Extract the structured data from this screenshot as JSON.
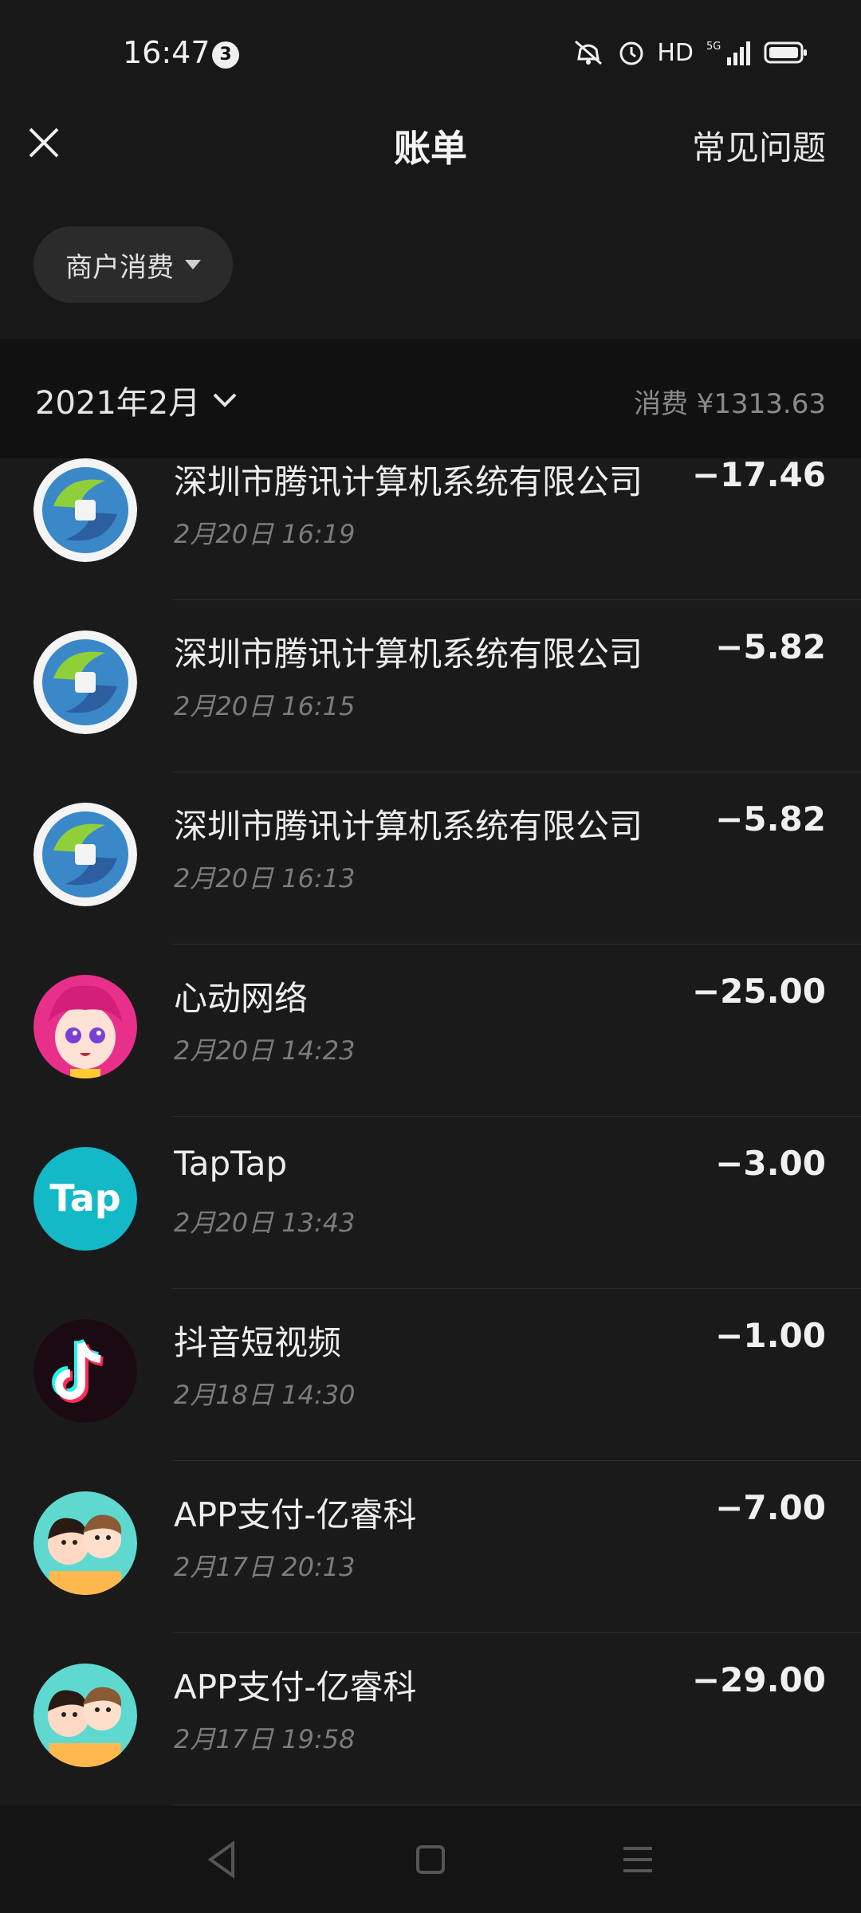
{
  "status": {
    "time": "16:47",
    "notif_count": "3",
    "hd": "HD",
    "network": "5G"
  },
  "header": {
    "title": "账单",
    "faq": "常见问题"
  },
  "filter": {
    "label": "商户消费"
  },
  "month": {
    "label": "2021年2月",
    "summary": "消费 ¥1313.63"
  },
  "transactions": [
    {
      "merchant": "深圳市腾讯计算机系统有限公司",
      "time": "2月20日 16:19",
      "amount": "−17.46",
      "icon": "tencent-logo-icon"
    },
    {
      "merchant": "深圳市腾讯计算机系统有限公司",
      "time": "2月20日 16:15",
      "amount": "−5.82",
      "icon": "tencent-logo-icon"
    },
    {
      "merchant": "深圳市腾讯计算机系统有限公司",
      "time": "2月20日 16:13",
      "amount": "−5.82",
      "icon": "tencent-logo-icon"
    },
    {
      "merchant": "心动网络",
      "time": "2月20日 14:23",
      "amount": "−25.00",
      "icon": "anime-girl-avatar-icon"
    },
    {
      "merchant": "TapTap",
      "time": "2月20日 13:43",
      "amount": "−3.00",
      "icon": "taptap-logo-icon"
    },
    {
      "merchant": "抖音短视频",
      "time": "2月18日 14:30",
      "amount": "−1.00",
      "icon": "tiktok-logo-icon"
    },
    {
      "merchant": "APP支付-亿睿科",
      "time": "2月17日 20:13",
      "amount": "−7.00",
      "icon": "couple-avatar-icon"
    },
    {
      "merchant": "APP支付-亿睿科",
      "time": "2月17日 19:58",
      "amount": "−29.00",
      "icon": "couple-avatar-icon"
    }
  ],
  "colors": {
    "background": "#1a1a1a",
    "taptap": "#14b9c8",
    "tiktok_pink": "#fe2c55",
    "tiktok_cyan": "#25f4ee"
  }
}
